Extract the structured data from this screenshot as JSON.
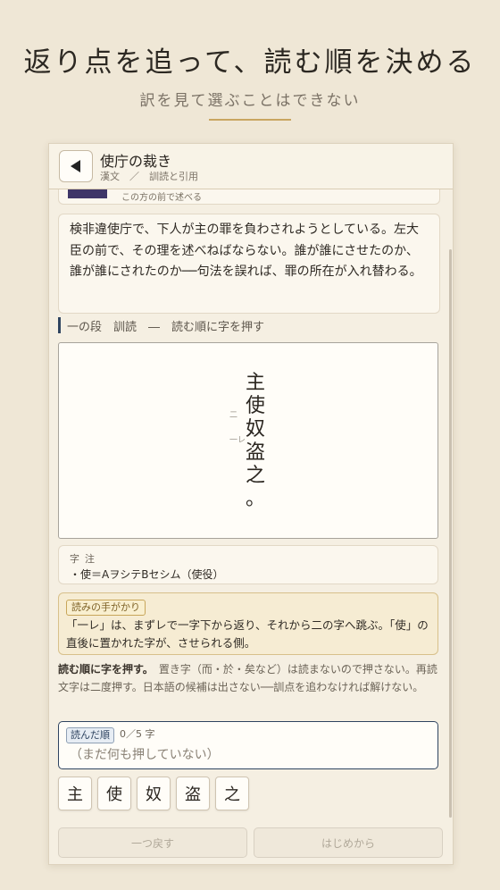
{
  "hero": {
    "title": "返り点を追って、読む順を決める",
    "subtitle": "訳を見て選ぶことはできない"
  },
  "header": {
    "back_icon": "back-arrow-icon",
    "title": "使庁の裁き",
    "subtitle": "漢文　／　訓読と引用"
  },
  "partial_card": {
    "text": "この方の前で述べる"
  },
  "intro": {
    "text": "検非違使庁で、下人が主の罪を負わされようとしている。左大臣の前で、その理を述べねばならない。誰が誰にさせたのか、誰が誰にされたのか──句法を誤れば、罪の所在が入れ替わる。"
  },
  "section": {
    "label": "一の段　訓読　―　読む順に字を押す"
  },
  "kanbun": {
    "chars": [
      "主",
      "使",
      "奴",
      "盗",
      "之",
      "。"
    ],
    "marks": {
      "second": "二",
      "fourth": "一レ"
    }
  },
  "jichu": {
    "title": "字注",
    "text": "・使＝AヲシテBセシム（使役）"
  },
  "hint": {
    "tag": "読みの手がかり",
    "text": "「一レ」は、まずレで一字下から返り、それから二の字へ跳ぶ。「使」の直後に置かれた字が、させられる側。"
  },
  "instruction": {
    "bold": "読む順に字を押す。",
    "rest": "　置き字（而・於・矣など）は読まないので押さない。再読文字は二度押す。日本語の候補は出さない──訓点を追わなければ解けない。"
  },
  "order": {
    "tag": "読んだ順",
    "count": "0／5 字",
    "empty_text": "（まだ何も押していない）"
  },
  "tiles": [
    "主",
    "使",
    "奴",
    "盗",
    "之"
  ],
  "footer": {
    "undo_label": "一つ戻す",
    "restart_label": "はじめから"
  }
}
